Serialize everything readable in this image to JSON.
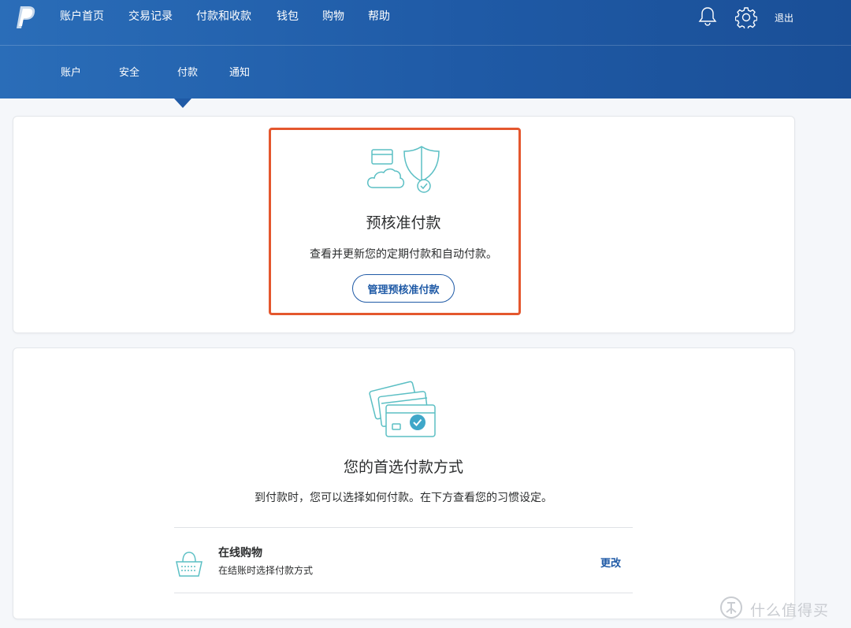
{
  "header": {
    "nav": [
      "账户首页",
      "交易记录",
      "付款和收款",
      "钱包",
      "购物",
      "帮助"
    ],
    "logout": "退出",
    "subnav": [
      "账户",
      "安全",
      "付款",
      "通知"
    ],
    "active_subnav": "付款"
  },
  "preapproved": {
    "title": "预核准付款",
    "description": "查看并更新您的定期付款和自动付款。",
    "button": "管理预核准付款"
  },
  "preferred": {
    "title": "您的首选付款方式",
    "description": "到付款时，您可以选择如何付款。在下方查看您的习惯设定。",
    "row": {
      "title": "在线购物",
      "subtitle": "在结账时选择付款方式",
      "action": "更改"
    }
  },
  "watermark": "什么值得买",
  "colors": {
    "brand_blue": "#1f5aa6",
    "highlight": "#e4572e",
    "icon_teal": "#5bbfc4"
  },
  "icons": [
    "paypal-logo",
    "bell-icon",
    "gear-icon",
    "cloud-shield-icon",
    "cards-check-icon",
    "basket-icon"
  ]
}
